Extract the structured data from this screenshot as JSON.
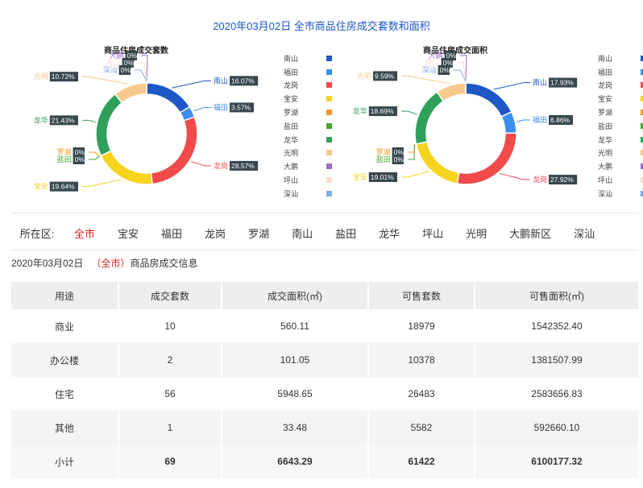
{
  "main_title": "2020年03月02日 全市商品住房成交套数和面积",
  "chart_data": [
    {
      "type": "pie",
      "title": "商品住房成交套数",
      "categories": [
        "南山",
        "福田",
        "龙岗",
        "宝安",
        "罗湖",
        "盐田",
        "龙华",
        "光明",
        "大鹏",
        "坪山",
        "深汕"
      ],
      "values": [
        16.07,
        3.57,
        28.57,
        19.64,
        0,
        0,
        21.43,
        10.72,
        0,
        0,
        0
      ],
      "unit": "%",
      "colors": [
        "#1d57c8",
        "#3c8ef0",
        "#f04a4a",
        "#f6d31d",
        "#f09a1f",
        "#48a52e",
        "#2ea05a",
        "#f8c98c",
        "#9b6cc8",
        "#f6ddd0",
        "#7fa8e8"
      ]
    },
    {
      "type": "pie",
      "title": "商品住房成交面积",
      "categories": [
        "南山",
        "福田",
        "龙岗",
        "宝安",
        "罗湖",
        "盐田",
        "龙华",
        "光明",
        "大鹏",
        "坪山",
        "深汕"
      ],
      "values": [
        17.93,
        6.86,
        27.92,
        19.01,
        0,
        0,
        18.69,
        9.59,
        0,
        0,
        0
      ],
      "unit": "%",
      "colors": [
        "#1d57c8",
        "#3c8ef0",
        "#f04a4a",
        "#f6d31d",
        "#f09a1f",
        "#48a52e",
        "#2ea05a",
        "#f8c98c",
        "#9b6cc8",
        "#f6ddd0",
        "#7fa8e8"
      ]
    }
  ],
  "district_filter": {
    "label": "所在区:",
    "options": [
      "全市",
      "宝安",
      "福田",
      "龙岗",
      "罗湖",
      "南山",
      "盐田",
      "龙华",
      "坪山",
      "光明",
      "大鹏新区",
      "深汕"
    ],
    "selected": "全市"
  },
  "info": {
    "date": "2020年03月02日",
    "district": "（全市）",
    "suffix": "商品房成交信息"
  },
  "table": {
    "headers": [
      "用途",
      "成交套数",
      "成交面积(㎡)",
      "可售套数",
      "可售面积(㎡)"
    ],
    "rows": [
      [
        "商业",
        "10",
        "560.11",
        "18979",
        "1542352.40"
      ],
      [
        "办公楼",
        "2",
        "101.05",
        "10378",
        "1381507.99"
      ],
      [
        "住宅",
        "56",
        "5948.65",
        "26483",
        "2583656.83"
      ],
      [
        "其他",
        "1",
        "33.48",
        "5582",
        "592660.10"
      ]
    ],
    "total": [
      "小计",
      "69",
      "6643.29",
      "61422",
      "6100177.32"
    ]
  }
}
